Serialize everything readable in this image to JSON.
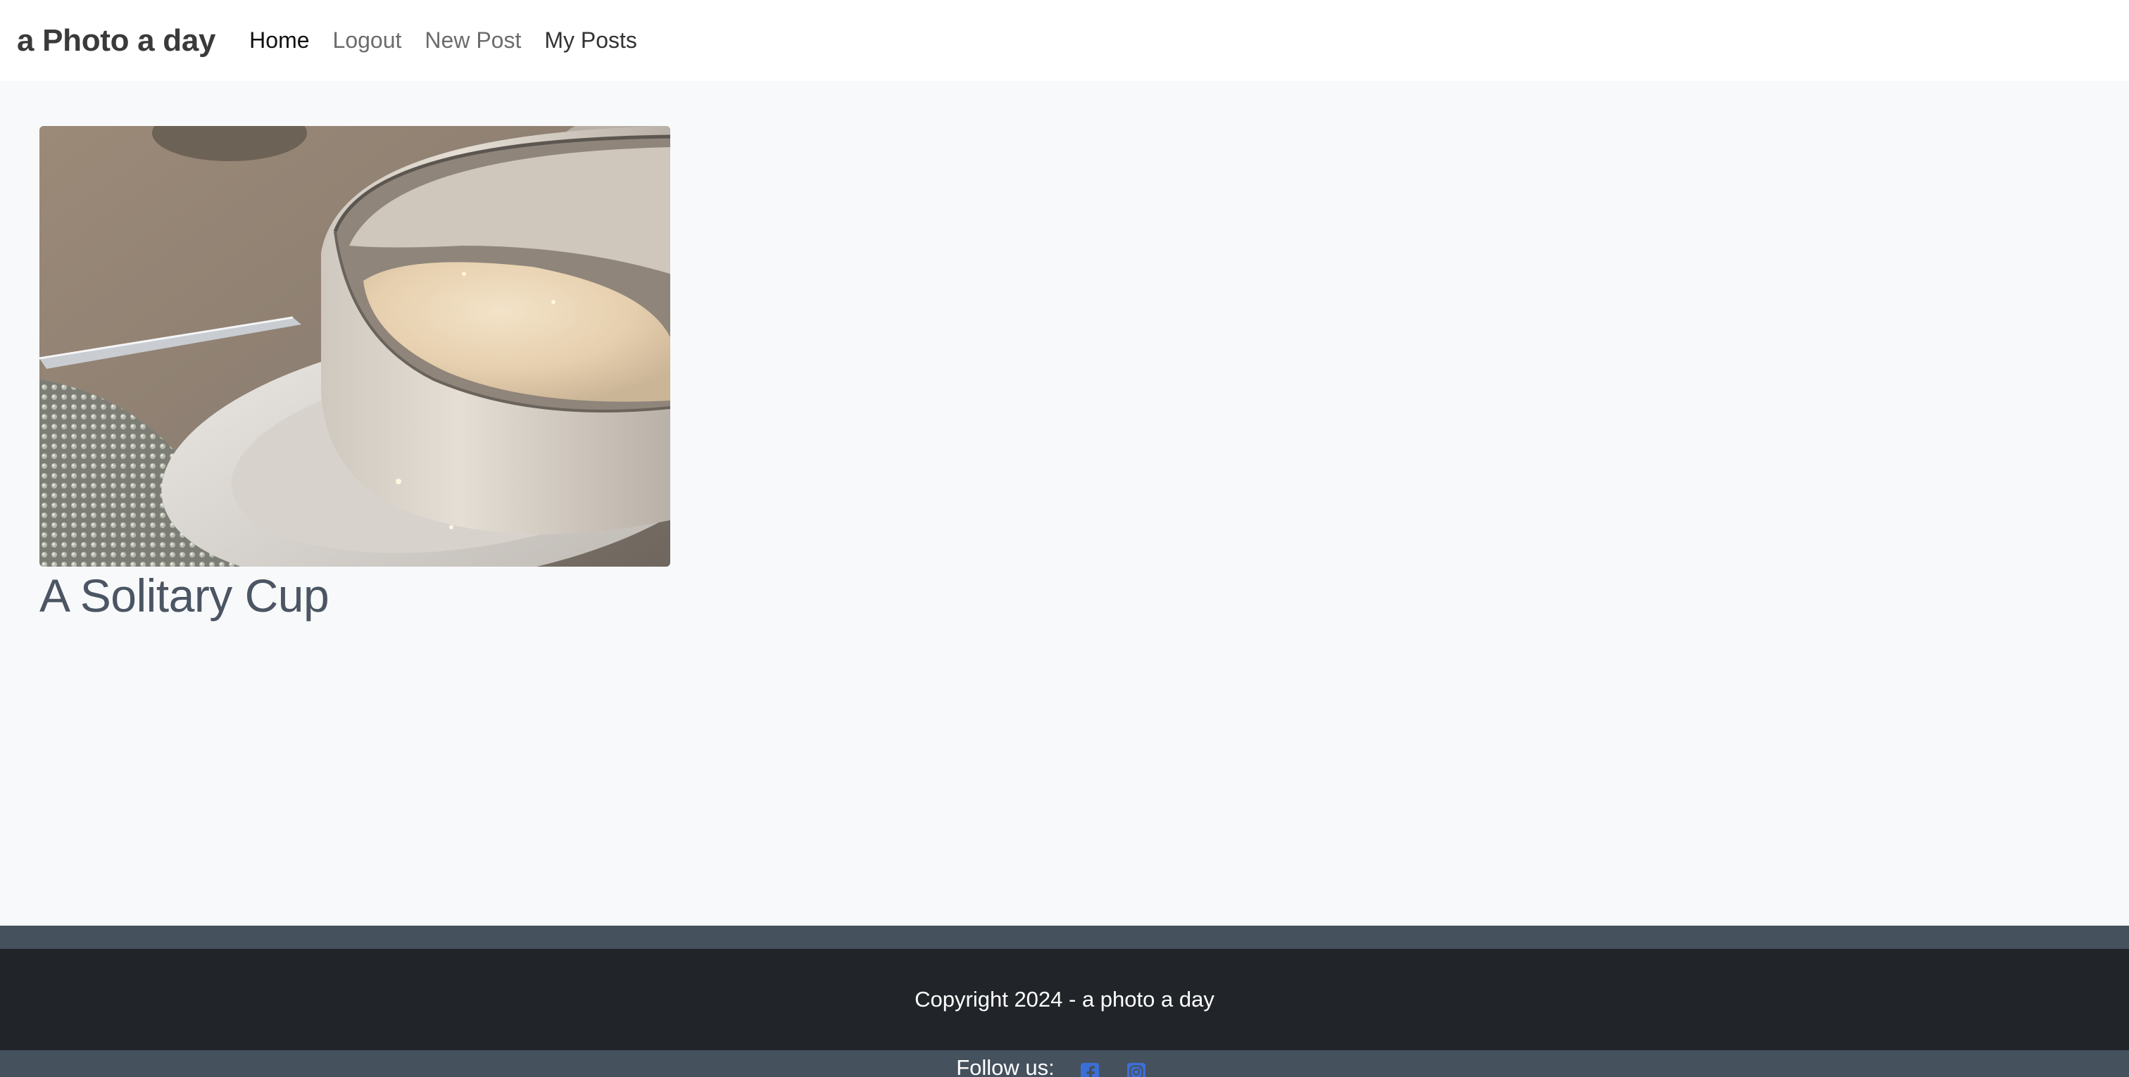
{
  "app": {
    "brand": "a Photo a day"
  },
  "nav": {
    "items": [
      {
        "label": "Home"
      },
      {
        "label": "Logout"
      },
      {
        "label": "New Post"
      },
      {
        "label": "My Posts"
      }
    ]
  },
  "posts": [
    {
      "title": "A Solitary Cup"
    }
  ],
  "footer": {
    "copyright": "Copyright 2024 - a photo a day",
    "follow_label": "Follow us:",
    "social_icons": [
      "facebook-icon",
      "instagram-icon"
    ]
  },
  "colors": {
    "navbar_bg": "#ffffff",
    "page_bg": "#f8f9fa",
    "footer_bg": "#212529",
    "footer_band": "#46515e",
    "social_accent": "#3b6fd8"
  }
}
